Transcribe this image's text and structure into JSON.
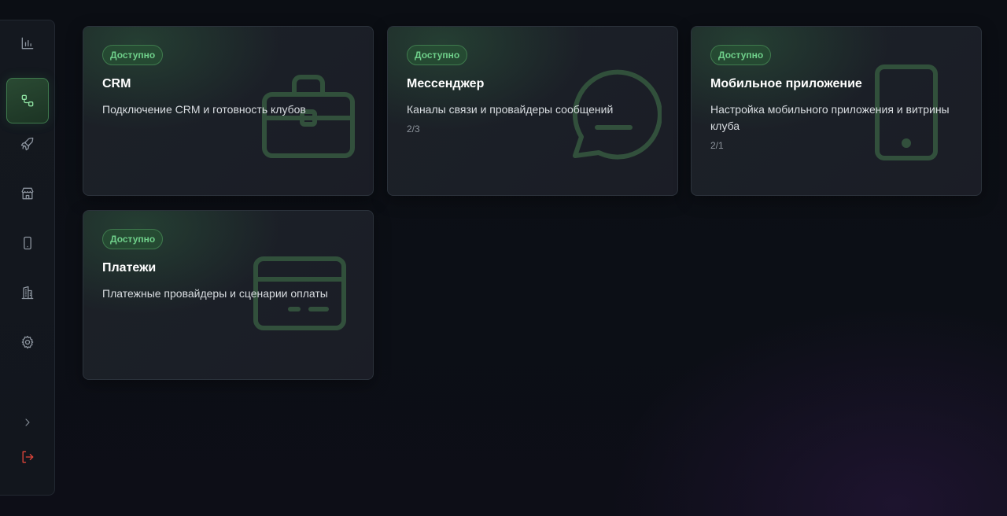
{
  "sidebar": {
    "items": [
      {
        "icon": "bar-chart-icon",
        "active": false
      },
      {
        "icon": "integrations-icon",
        "active": true
      },
      {
        "icon": "rocket-icon",
        "active": false
      },
      {
        "icon": "store-icon",
        "active": false
      },
      {
        "icon": "mobile-icon",
        "active": false
      },
      {
        "icon": "building-icon",
        "active": false
      },
      {
        "icon": "gear-icon",
        "active": false
      }
    ],
    "expand_icon": "chevron-right-icon",
    "logout_icon": "logout-icon"
  },
  "colors": {
    "accent": "#6fd08a",
    "logout": "#e0453a"
  },
  "cards": [
    {
      "badge": "Доступно",
      "title": "CRM",
      "description": "Подключение CRM и готовность клубов",
      "count": "",
      "icon": "briefcase-icon"
    },
    {
      "badge": "Доступно",
      "title": "Мессенджер",
      "description": "Каналы связи и провайдеры сообщений",
      "count": "2/3",
      "icon": "chat-bubble-icon"
    },
    {
      "badge": "Доступно",
      "title": "Мобильное приложение",
      "description": "Настройка мобильного приложения и витрины клуба",
      "count": "2/1",
      "icon": "smartphone-icon"
    },
    {
      "badge": "Доступно",
      "title": "Платежи",
      "description": "Платежные провайдеры и сценарии оплаты",
      "count": "",
      "icon": "credit-card-icon"
    }
  ]
}
